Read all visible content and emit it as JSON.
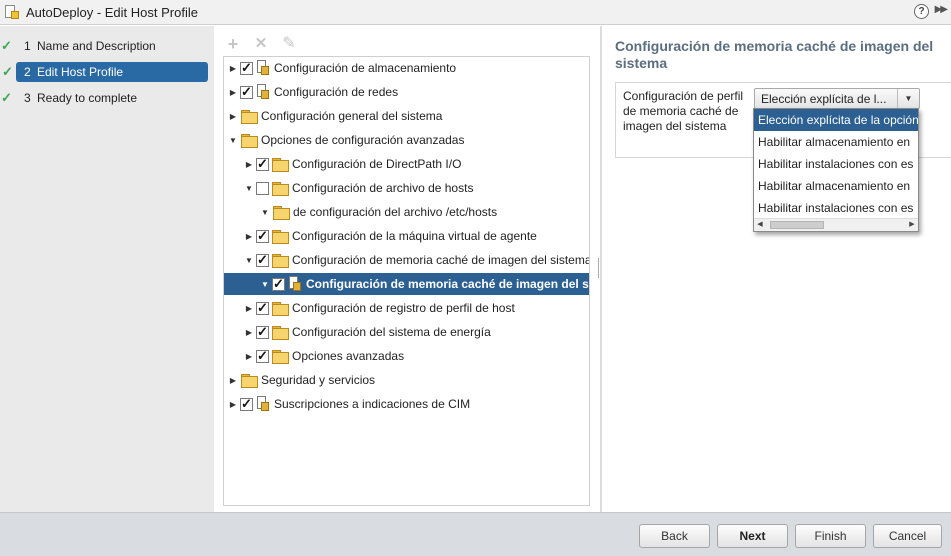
{
  "window": {
    "title": "AutoDeploy - Edit Host Profile",
    "help": "?",
    "expand": "▶▶"
  },
  "steps": [
    {
      "num": "1",
      "label": "Name and Description",
      "done": true
    },
    {
      "num": "2",
      "label": "Edit Host Profile",
      "done": true,
      "active": true
    },
    {
      "num": "3",
      "label": "Ready to complete",
      "done": true
    }
  ],
  "toolbar": {
    "add": "+",
    "remove": "✕",
    "edit": "✎"
  },
  "tree": [
    {
      "label": "Configuración de almacenamiento",
      "depth": 0,
      "twisty": "▶",
      "checkbox": "checked",
      "icon": "profile"
    },
    {
      "label": "Configuración de redes",
      "depth": 0,
      "twisty": "▶",
      "checkbox": "checked",
      "icon": "profile"
    },
    {
      "label": "Configuración general del sistema",
      "depth": 0,
      "twisty": "▶",
      "checkbox": "none",
      "icon": "folder"
    },
    {
      "label": "Opciones de configuración avanzadas",
      "depth": 0,
      "twisty": "▼",
      "checkbox": "none",
      "icon": "folder"
    },
    {
      "label": "Configuración de DirectPath I/O",
      "depth": 1,
      "twisty": "▶",
      "checkbox": "checked",
      "icon": "folder"
    },
    {
      "label": "Configuración de archivo de hosts",
      "depth": 1,
      "twisty": "▼",
      "checkbox": "unchecked",
      "icon": "folder"
    },
    {
      "label": "de configuración del archivo /etc/hosts",
      "depth": 2,
      "twisty": "▼",
      "checkbox": "none",
      "icon": "folder"
    },
    {
      "label": "Configuración de la máquina virtual de agente",
      "depth": 1,
      "twisty": "▶",
      "checkbox": "checked",
      "icon": "folder"
    },
    {
      "label": "Configuración de memoria caché de imagen del sistema",
      "depth": 1,
      "twisty": "▼",
      "checkbox": "checked",
      "icon": "folder"
    },
    {
      "label": "Configuración de memoria caché de imagen del sistema",
      "depth": 2,
      "twisty": "▼",
      "checkbox": "checked",
      "icon": "profile",
      "selected": true
    },
    {
      "label": "Configuración de registro de perfil de host",
      "depth": 1,
      "twisty": "▶",
      "checkbox": "checked",
      "icon": "folder"
    },
    {
      "label": "Configuración del sistema de energía",
      "depth": 1,
      "twisty": "▶",
      "checkbox": "checked",
      "icon": "folder"
    },
    {
      "label": "Opciones avanzadas",
      "depth": 1,
      "twisty": "▶",
      "checkbox": "checked",
      "icon": "folder"
    },
    {
      "label": "Seguridad y servicios",
      "depth": 0,
      "twisty": "▶",
      "checkbox": "none",
      "icon": "folder"
    },
    {
      "label": "Suscripciones a indicaciones de CIM",
      "depth": 0,
      "twisty": "▶",
      "checkbox": "checked",
      "icon": "profile"
    }
  ],
  "details": {
    "title": "Configuración de memoria caché de imagen del sistema",
    "field_label": "Configuración de perfil de memoria caché de imagen del sistema",
    "select_value": "Elección explícita de l...",
    "options": [
      "Elección explícita de la opción",
      "Habilitar almacenamiento en",
      "Habilitar instalaciones con es",
      "Habilitar almacenamiento en",
      "Habilitar instalaciones con es"
    ],
    "selected_option_index": 0
  },
  "footer": {
    "back": "Back",
    "next": "Next",
    "finish": "Finish",
    "cancel": "Cancel"
  },
  "colors": {
    "selection": "#2c5f92",
    "step_active": "#2a6aa4",
    "check": "#3aa655",
    "panel_title": "#5a6e80"
  }
}
